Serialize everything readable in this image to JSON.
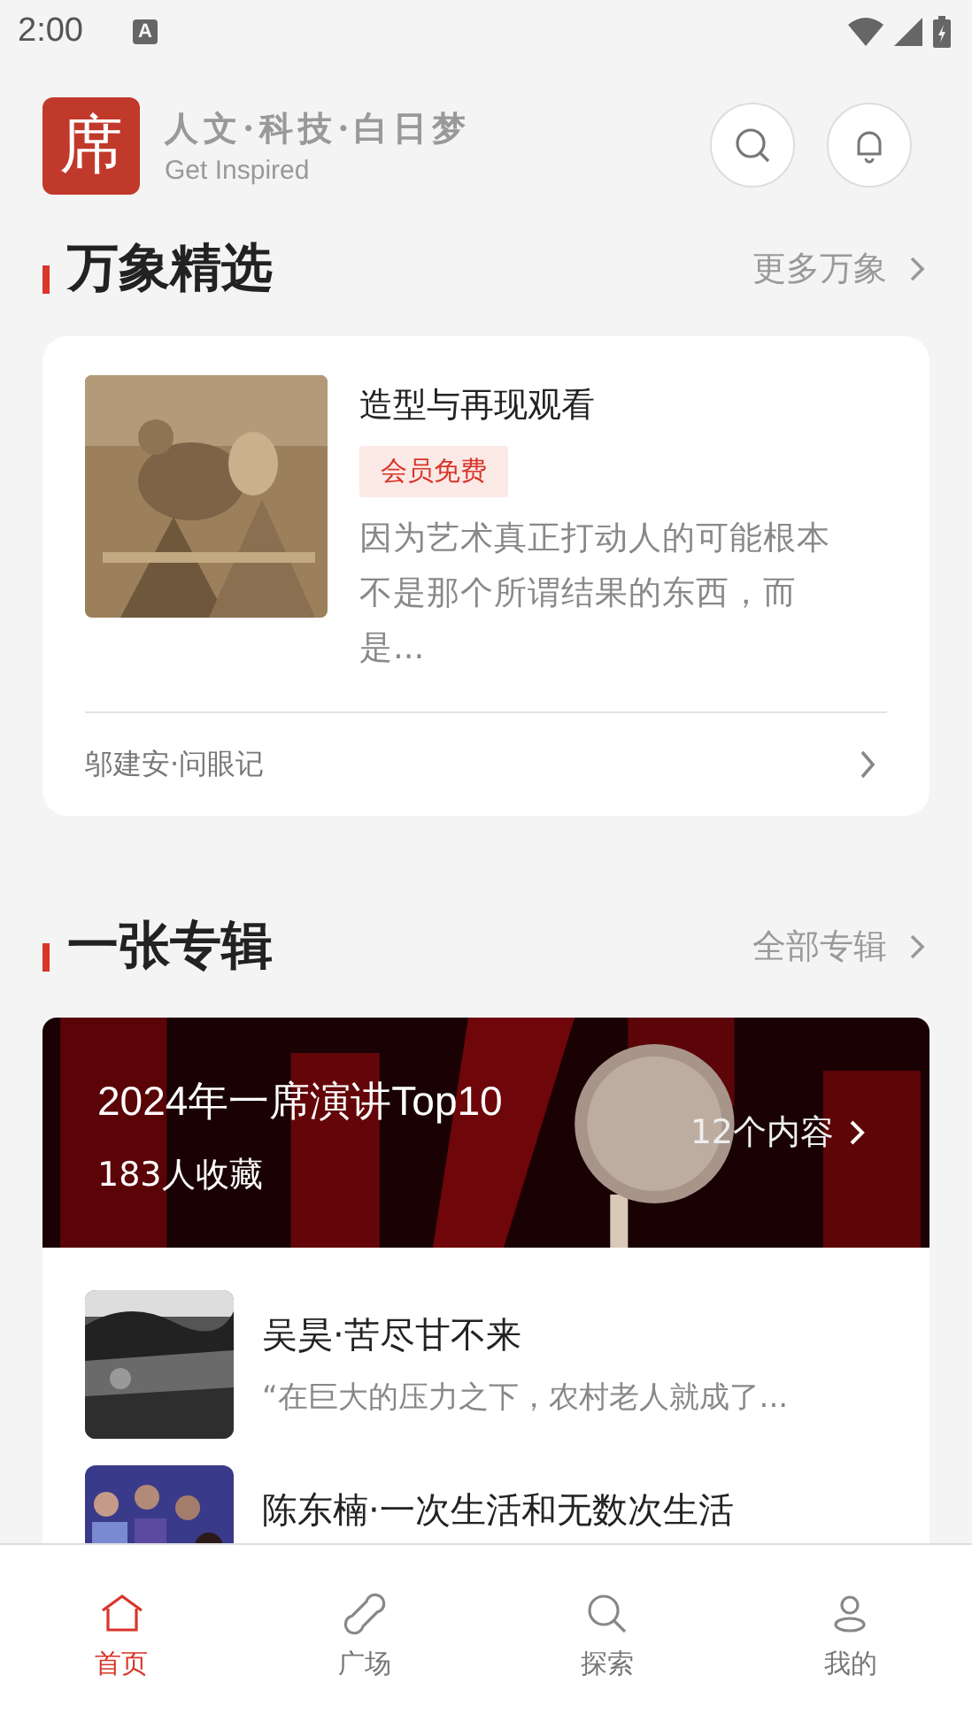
{
  "status_bar": {
    "time": "2:00",
    "notification_glyph": "A"
  },
  "header": {
    "logo_char": "席",
    "slogan": "人文·科技·白日梦",
    "subtitle": "Get Inspired"
  },
  "featured": {
    "title": "万象精选",
    "more": "更多万象",
    "card": {
      "kind": "picture",
      "title": "造型与再现观看",
      "badge": "会员免费",
      "excerpt": "因为艺术真正打动人的可能根本不是那个所谓结果的东西，而是...",
      "author": "邬建安·问眼记"
    }
  },
  "albums": {
    "title": "一张专辑",
    "more": "全部专辑",
    "banner": {
      "title": "2024年一席演讲Top10",
      "saves": "183人收藏",
      "count": "12个内容"
    },
    "items": [
      {
        "kind": "landscape",
        "title": "吴昊·苦尽甘不来",
        "excerpt": "“在巨大的压力之下，农村老人就成了..."
      },
      {
        "kind": "crowd",
        "title": "陈东楠·一次生活和无数次生活"
      }
    ]
  },
  "tabs": [
    {
      "label": "首页",
      "kind": "home",
      "selected": true
    },
    {
      "label": "广场",
      "kind": "link",
      "selected": false
    },
    {
      "label": "探索",
      "kind": "search",
      "selected": false
    },
    {
      "label": "我的",
      "kind": "user",
      "selected": false
    }
  ]
}
